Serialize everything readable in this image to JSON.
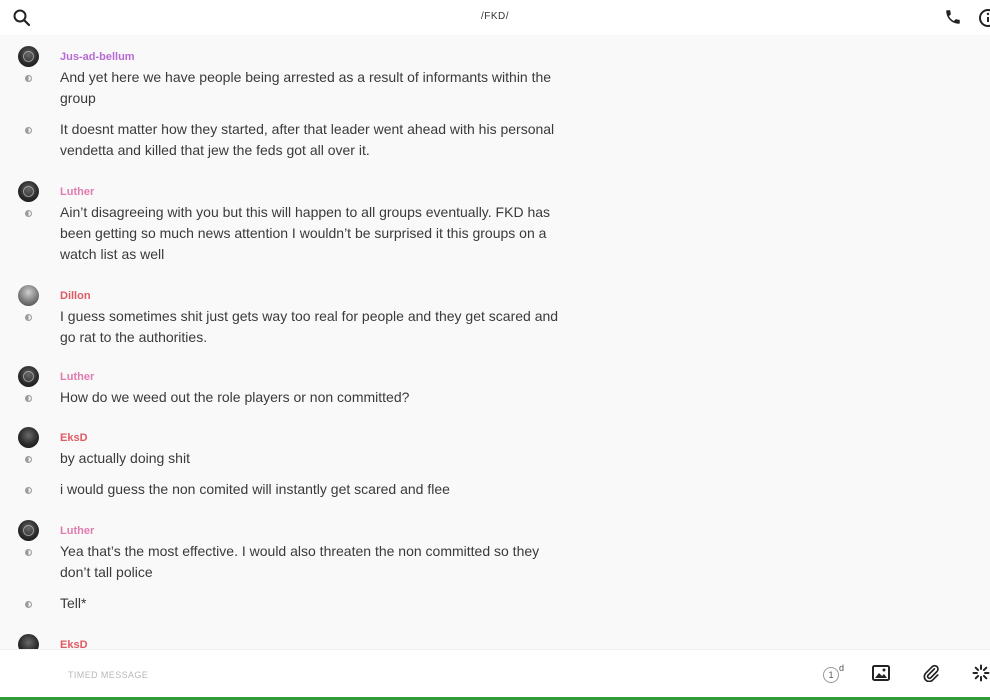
{
  "header": {
    "title": "/FKD/"
  },
  "messages": [
    {
      "sender": "Jus-ad-bellum",
      "text": "And yet here we have people being arrested as a result of informants within the group"
    },
    {
      "sender": "",
      "text": "It doesnt matter how they started, after that leader went ahead with his personal vendetta and killed that jew the feds got all over it."
    },
    {
      "sender": "Luther",
      "text": "Ain’t disagreeing with you but this will happen to all groups eventually. FKD has been getting so much news attention I wouldn’t be surprised it this groups on a watch list as well"
    },
    {
      "sender": "Dillon",
      "text": "I guess sometimes shit just gets way too real for people and they get scared and go rat to the authorities."
    },
    {
      "sender": "Luther",
      "text": "How do we weed out the role players or non committed?"
    },
    {
      "sender": "EksD",
      "text": "by actually doing shit"
    },
    {
      "sender": "",
      "text": "i would guess the non comited will instantly get scared and flee"
    },
    {
      "sender": "Luther",
      "text": "Yea that’s the most effective. I would also threaten the non committed so they don’t tall police"
    },
    {
      "sender": "",
      "text": "Tell*"
    },
    {
      "sender": "EksD",
      "text": ""
    }
  ],
  "composer": {
    "placeholder": "TIMED MESSAGE",
    "timer_value": "1",
    "timer_unit": "d"
  },
  "icons": {
    "search": "search-icon",
    "call": "phone-icon",
    "info": "info-icon",
    "image": "image-icon",
    "attach": "paperclip-icon",
    "more": "spinner-icon"
  },
  "colors": {
    "sender_purple": "#b86ad4",
    "sender_pink": "#e07bb0",
    "sender_red": "#e05a64",
    "accent_green": "#2f9e3a"
  }
}
